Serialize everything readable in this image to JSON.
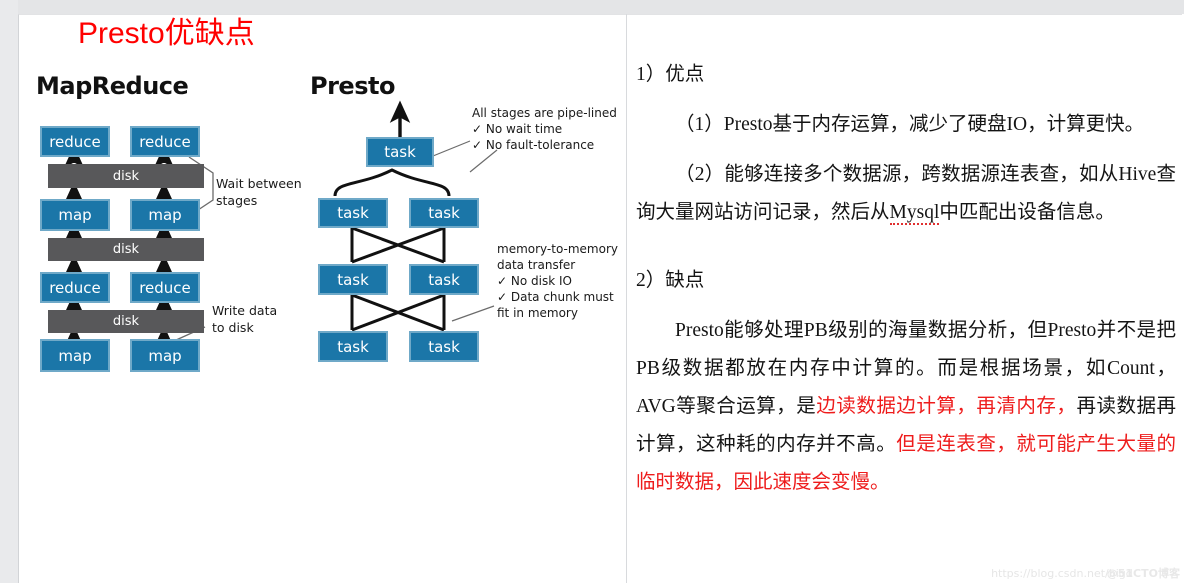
{
  "slide": {
    "title": "Presto优缺点",
    "title_color": "#ff0000"
  },
  "diagrams": {
    "mapreduce": {
      "heading": "MapReduce",
      "box_color": "#1b76a8",
      "disk_color": "#58585a",
      "nodes": [
        {
          "label": "reduce"
        },
        {
          "label": "reduce"
        },
        {
          "label": "disk"
        },
        {
          "label": "map"
        },
        {
          "label": "map"
        },
        {
          "label": "disk"
        },
        {
          "label": "reduce"
        },
        {
          "label": "reduce"
        },
        {
          "label": "disk"
        },
        {
          "label": "map"
        },
        {
          "label": "map"
        }
      ],
      "labels": {
        "reduce": "reduce",
        "map": "map",
        "disk": "disk"
      },
      "annotations": [
        "Wait between\nstages",
        "Write data\nto disk"
      ]
    },
    "presto": {
      "heading": "Presto",
      "box_color": "#1b76a8",
      "task_label": "task",
      "annotations": [
        "All stages are pipe-lined\n✓ No wait time\n✓ No fault-tolerance",
        "memory-to-memory\ndata transfer\n✓ No disk IO\n✓ Data chunk must\n    fit in memory"
      ]
    }
  },
  "content": {
    "section1_heading": "1）优点",
    "section1_item1": "（1）Presto基于内存运算，减少了硬盘IO，计算更快。",
    "section1_item2_a": "（2）能够连接多个数据源，跨数据源连表查，如从Hive查询大量网站访问记录，然后从",
    "section1_item2_spell": "Mysql",
    "section1_item2_b": "中匹配出设备信息。",
    "section2_heading": "2）缺点",
    "section2_p1_black1": "Presto能够处理PB级别的海量数据分析，但Presto并不是把PB级数据都放在内存中计算的。而是根据场景，如Count，AVG等聚合运算，是",
    "section2_p1_red1": "边读数据边计算，再清内存，",
    "section2_p1_black2": "再读数据再计算，这种耗的内存并不高。",
    "section2_p1_red2": "但是连表查，就可能产生大量的临时数据，因此速度会变慢。",
    "red_accent": "#ee1c1c"
  },
  "watermark": {
    "url": "https://blog.csdn.net/bigd",
    "brand": "@51CTO博客"
  }
}
